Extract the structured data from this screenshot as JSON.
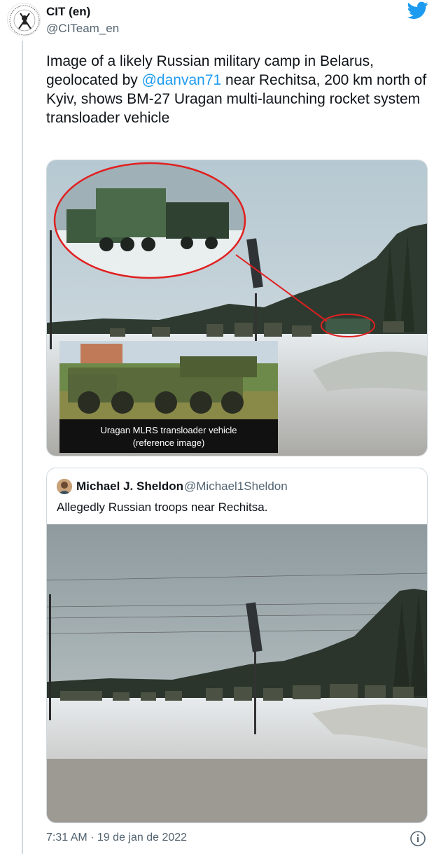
{
  "author": {
    "name": "CIT (en)",
    "handle": "@CITeam_en",
    "avatar_icon": "cit-logo-icon",
    "platform_icon": "twitter-bird-icon"
  },
  "tweet": {
    "text_before": "Image of a likely Russian military camp in Belarus, geolocated by ",
    "mention": "@danvan71",
    "text_after": " near Rechitsa, 200 km north of Kyiv, shows BM-27 Uragan multi-launching rocket system transloader vehicle"
  },
  "media": {
    "caption_line1": "Uragan MLRS transloader vehicle",
    "caption_line2": "(reference image)"
  },
  "quoted_tweet": {
    "name": "Michael J. Sheldon",
    "handle": "@Michael1Sheldon",
    "text": "Allegedly Russian troops near Rechitsa."
  },
  "footer": {
    "timestamp": "7:31 AM · 19 de jan de 2022",
    "info_icon": "info-icon"
  },
  "colors": {
    "link": "#1d9bf0",
    "secondary_text": "#536471",
    "border": "#cfd9de"
  }
}
